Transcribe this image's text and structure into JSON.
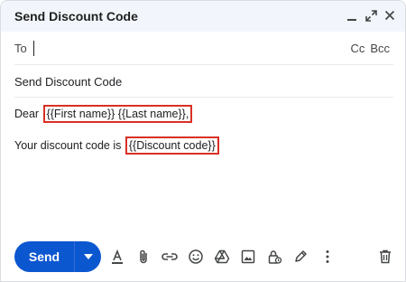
{
  "window": {
    "title": "Send Discount Code",
    "controls": [
      "minimize-icon",
      "expand-icon",
      "close-icon"
    ]
  },
  "recipients": {
    "to_label": "To",
    "cc_label": "Cc",
    "bcc_label": "Bcc"
  },
  "subject": "Send Discount Code",
  "body": {
    "line1_prefix": "Dear ",
    "line1_placeholder": "{{First name}} {{Last name}},",
    "line2_prefix": "Your discount code is ",
    "line2_placeholder": "{{Discount code}}"
  },
  "toolbar": {
    "send_label": "Send",
    "icons": [
      "format-text-icon",
      "attach-icon",
      "link-icon",
      "emoji-icon",
      "drive-icon",
      "photo-icon",
      "confidential-lock-icon",
      "signature-pen-icon",
      "more-options-icon",
      "trash-icon"
    ]
  },
  "colors": {
    "accent": "#0b57d0",
    "header_bg": "#f2f6fc",
    "highlight_border": "#d93025"
  }
}
